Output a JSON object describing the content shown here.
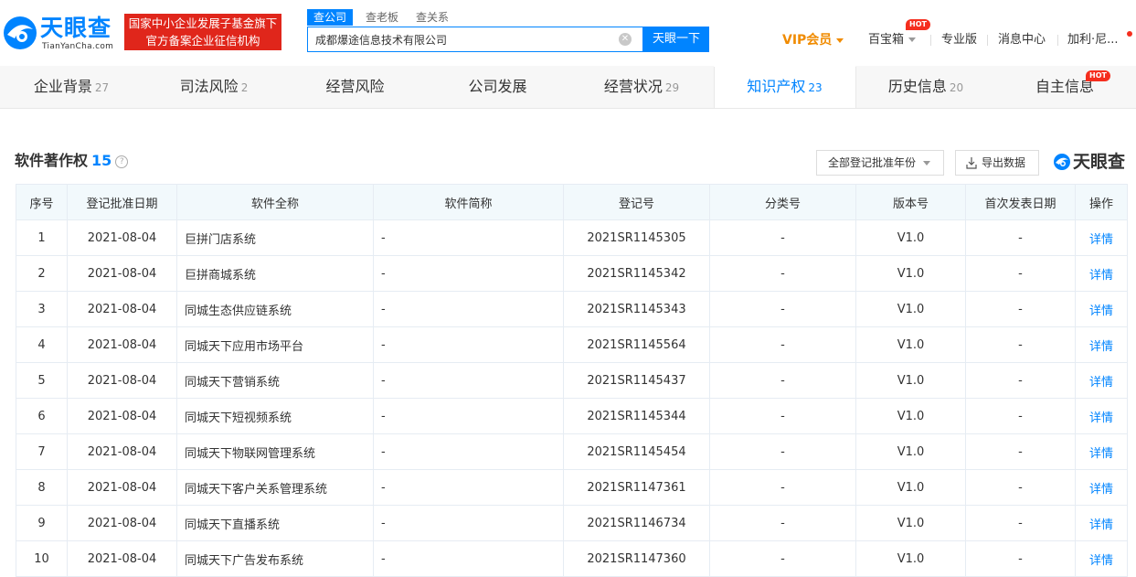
{
  "header": {
    "logo_cn": "天眼查",
    "logo_en": "TianYanCha.com",
    "banner_line1": "国家中小企业发展子基金旗下",
    "banner_line2": "官方备案企业征信机构",
    "search_tabs": [
      "查公司",
      "查老板",
      "查关系"
    ],
    "search_value": "成都爆途信息技术有限公司",
    "search_button": "天眼一下",
    "nav": {
      "vip": "VIP会员",
      "treasure": "百宝箱",
      "hot": "HOT",
      "pro": "专业版",
      "messages": "消息中心",
      "user": "加利·尼..."
    }
  },
  "tabs": [
    {
      "label": "企业背景",
      "count": "27"
    },
    {
      "label": "司法风险",
      "count": "2"
    },
    {
      "label": "经营风险",
      "count": ""
    },
    {
      "label": "公司发展",
      "count": ""
    },
    {
      "label": "经营状况",
      "count": "29"
    },
    {
      "label": "知识产权",
      "count": "23"
    },
    {
      "label": "历史信息",
      "count": "20"
    },
    {
      "label": "自主信息",
      "count": ""
    }
  ],
  "tabs_hot": "HOT",
  "section": {
    "title": "软件著作权",
    "count": "15",
    "help": "?",
    "filter": "全部登记批准年份",
    "export": "导出数据",
    "watermark": "天眼查"
  },
  "table": {
    "headers": [
      "序号",
      "登记批准日期",
      "软件全称",
      "软件简称",
      "登记号",
      "分类号",
      "版本号",
      "首次发表日期",
      "操作"
    ],
    "rows": [
      [
        "1",
        "2021-08-04",
        "巨拼门店系统",
        "-",
        "2021SR1145305",
        "-",
        "V1.0",
        "-",
        "详情"
      ],
      [
        "2",
        "2021-08-04",
        "巨拼商城系统",
        "-",
        "2021SR1145342",
        "-",
        "V1.0",
        "-",
        "详情"
      ],
      [
        "3",
        "2021-08-04",
        "同城生态供应链系统",
        "-",
        "2021SR1145343",
        "-",
        "V1.0",
        "-",
        "详情"
      ],
      [
        "4",
        "2021-08-04",
        "同城天下应用市场平台",
        "-",
        "2021SR1145564",
        "-",
        "V1.0",
        "-",
        "详情"
      ],
      [
        "5",
        "2021-08-04",
        "同城天下营销系统",
        "-",
        "2021SR1145437",
        "-",
        "V1.0",
        "-",
        "详情"
      ],
      [
        "6",
        "2021-08-04",
        "同城天下短视频系统",
        "-",
        "2021SR1145344",
        "-",
        "V1.0",
        "-",
        "详情"
      ],
      [
        "7",
        "2021-08-04",
        "同城天下物联网管理系统",
        "-",
        "2021SR1145454",
        "-",
        "V1.0",
        "-",
        "详情"
      ],
      [
        "8",
        "2021-08-04",
        "同城天下客户关系管理系统",
        "-",
        "2021SR1147361",
        "-",
        "V1.0",
        "-",
        "详情"
      ],
      [
        "9",
        "2021-08-04",
        "同城天下直播系统",
        "-",
        "2021SR1146734",
        "-",
        "V1.0",
        "-",
        "详情"
      ],
      [
        "10",
        "2021-08-04",
        "同城天下广告发布系统",
        "-",
        "2021SR1147360",
        "-",
        "V1.0",
        "-",
        "详情"
      ]
    ]
  },
  "colors": {
    "brand_blue": "#0084ff",
    "banner_red": "#e0261b",
    "vip_orange": "#f08b00",
    "table_header_bg": "#f2f9fc"
  }
}
